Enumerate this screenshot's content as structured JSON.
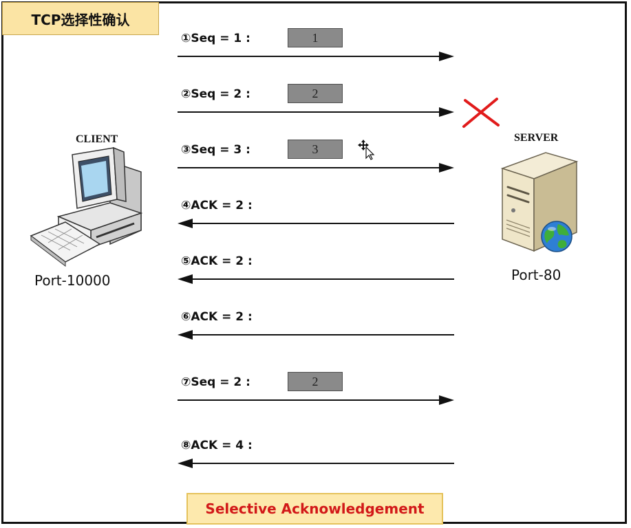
{
  "title": "TCP选择性确认",
  "client": {
    "name": "CLIENT",
    "port": "Port-10000"
  },
  "server": {
    "name": "SERVER",
    "port": "Port-80"
  },
  "messages": [
    {
      "label": "①Seq = 1 :",
      "direction": "to-server",
      "packet": "1"
    },
    {
      "label": "②Seq = 2 :",
      "direction": "to-server",
      "packet": "2",
      "lost": true
    },
    {
      "label": "③Seq = 3 :",
      "direction": "to-server",
      "packet": "3"
    },
    {
      "label": "④ACK = 2 :",
      "direction": "to-client"
    },
    {
      "label": "⑤ACK = 2 :",
      "direction": "to-client"
    },
    {
      "label": "⑥ACK = 2 :",
      "direction": "to-client"
    },
    {
      "label": "⑦Seq = 2 :",
      "direction": "to-server",
      "packet": "2"
    },
    {
      "label": "⑧ACK = 4 :",
      "direction": "to-client"
    }
  ],
  "footer": "Selective Acknowledgement",
  "colors": {
    "title_bg": "#fbe4a4",
    "footer_bg": "#fde9ad",
    "footer_text": "#d21919",
    "packet_fill": "#8a8a8a",
    "lost_mark": "#e11b1b"
  },
  "icons": {
    "client": "desktop-computer-icon",
    "server": "server-tower-icon",
    "globe": "globe-icon",
    "lost": "x-mark-icon",
    "cursor": "move-cursor-icon"
  }
}
